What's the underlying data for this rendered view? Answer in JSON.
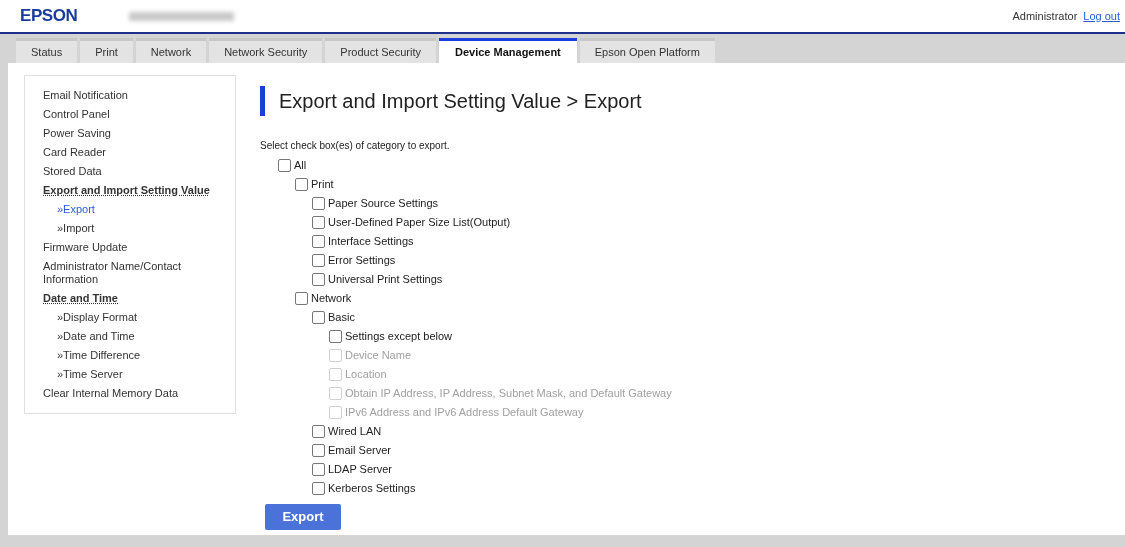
{
  "header": {
    "brand": "EPSON",
    "user": "Administrator",
    "logout": "Log out"
  },
  "tabs": [
    {
      "label": "Status",
      "selected": false
    },
    {
      "label": "Print",
      "selected": false
    },
    {
      "label": "Network",
      "selected": false
    },
    {
      "label": "Network Security",
      "selected": false
    },
    {
      "label": "Product Security",
      "selected": false
    },
    {
      "label": "Device Management",
      "selected": true
    },
    {
      "label": "Epson Open Platform",
      "selected": false
    }
  ],
  "sidebar": {
    "items": [
      {
        "label": "Email Notification"
      },
      {
        "label": "Control Panel"
      },
      {
        "label": "Power Saving"
      },
      {
        "label": "Card Reader"
      },
      {
        "label": "Stored Data"
      },
      {
        "label": "Export and Import Setting Value",
        "children": [
          {
            "label": "»Export",
            "selected": true
          },
          {
            "label": "»Import",
            "selected": false
          }
        ]
      },
      {
        "label": "Firmware Update"
      },
      {
        "label": "Administrator Name/Contact Information"
      },
      {
        "label": "Date and Time",
        "children": [
          {
            "label": "»Display Format",
            "selected": false
          },
          {
            "label": "»Date and Time",
            "selected": false
          },
          {
            "label": "»Time Difference",
            "selected": false
          },
          {
            "label": "»Time Server",
            "selected": false
          }
        ]
      },
      {
        "label": "Clear Internal Memory Data"
      }
    ]
  },
  "page": {
    "title": "Export and Import Setting Value > Export",
    "instruction": "Select check box(es) of category to export.",
    "categories": [
      {
        "label": "All",
        "checked": false,
        "disabled": false,
        "children": [
          {
            "label": "Print",
            "checked": false,
            "disabled": false,
            "children": [
              {
                "label": "Paper Source Settings",
                "checked": false,
                "disabled": false
              },
              {
                "label": "User-Defined Paper Size List(Output)",
                "checked": false,
                "disabled": false
              },
              {
                "label": "Interface Settings",
                "checked": false,
                "disabled": false
              },
              {
                "label": "Error Settings",
                "checked": false,
                "disabled": false
              },
              {
                "label": "Universal Print Settings",
                "checked": false,
                "disabled": false
              }
            ]
          },
          {
            "label": "Network",
            "checked": false,
            "disabled": false,
            "children": [
              {
                "label": "Basic",
                "checked": false,
                "disabled": false,
                "children": [
                  {
                    "label": "Settings except below",
                    "checked": false,
                    "disabled": false
                  },
                  {
                    "label": "Device Name",
                    "checked": false,
                    "disabled": true
                  },
                  {
                    "label": "Location",
                    "checked": false,
                    "disabled": true
                  },
                  {
                    "label": "Obtain IP Address, IP Address, Subnet Mask, and Default Gateway",
                    "checked": false,
                    "disabled": true
                  },
                  {
                    "label": "IPv6 Address and IPv6 Address Default Gateway",
                    "checked": false,
                    "disabled": true
                  }
                ]
              },
              {
                "label": "Wired LAN",
                "checked": false,
                "disabled": false
              },
              {
                "label": "Email Server",
                "checked": false,
                "disabled": false
              },
              {
                "label": "LDAP Server",
                "checked": false,
                "disabled": false
              },
              {
                "label": "Kerberos Settings",
                "checked": false,
                "disabled": false
              }
            ]
          }
        ]
      }
    ],
    "button": "Export"
  }
}
